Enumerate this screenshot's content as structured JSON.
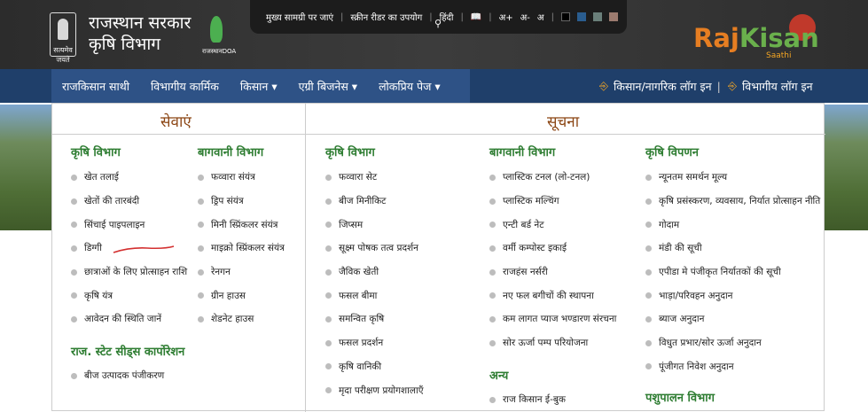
{
  "header": {
    "title_line1": "राजस्थान सरकार",
    "title_line2": "कृषि विभाग",
    "emblem_caption": "सत्यमेव जयते",
    "doa_caption": "राजस्थानDOA"
  },
  "topbar": {
    "skip": "मुख्य सामग्री पर जाएं",
    "reader": "स्क्रीन रीडर का उपयोग",
    "lang": "हिंदी",
    "font_plus": "अ+",
    "font_minus": "अ-",
    "font_normal": "अ",
    "swatches": [
      "#000000",
      "#2a5d8f",
      "#6a7f7a",
      "#9c7b6f"
    ]
  },
  "logo": {
    "part1": "Raj",
    "part2": "Kisan",
    "sub": "Saathi"
  },
  "nav": {
    "items": [
      "राजकिसान साथी",
      "विभागीय कार्मिक",
      "किसान",
      "एग्री बिजनेस",
      "लोकप्रिय पेज"
    ],
    "farmer_login": "किसान/नागरिक लॉग इन",
    "dept_login": "विभागीय लॉग इन"
  },
  "menu": {
    "seva_title": "सेवाएं",
    "suchna_title": "सूचना",
    "seva": {
      "krishi_title": "कृषि विभाग",
      "krishi": [
        "खेत तलाई",
        "खेतों की तारबंदी",
        "सिंचाई पाइपलाइन",
        "डिग्गी",
        "छात्राओं के लिए प्रोत्साहन राशि",
        "कृषि यंत्र",
        "आवेदन की स्थिति जानें"
      ],
      "bagwani_title": "बागवानी विभाग",
      "bagwani": [
        "फव्वारा संयंत्र",
        "ड्रिप संयंत्र",
        "मिनी स्प्रिंकलर संयंत्र",
        "माइक्रो स्प्रिंकलर संयंत्र",
        "रेनगन",
        "ग्रीन हाउस",
        "शेडनेट हाउस"
      ],
      "seeds_title": "राज. स्टेट सीड्स कार्पोरेशन",
      "seeds": [
        "बीज उत्पादक पंजीकरण"
      ]
    },
    "suchna": {
      "krishi_title": "कृषि विभाग",
      "krishi": [
        "फव्वारा सेट",
        "बीज मिनीकिट",
        "जिप्सम",
        "सूक्ष्म पोषक तत्व प्रदर्शन",
        "जैविक खेती",
        "फसल बीमा",
        "समन्वित कृषि",
        "फसल प्रदर्शन",
        "कृषि वानिकी",
        "मृदा परीक्षण प्रयोगशालाएँ"
      ],
      "bagwani_title": "बागवानी विभाग",
      "bagwani": [
        "प्लास्टिक टनल (लो-टनल)",
        "प्लास्टिक मल्चिंग",
        "एन्टी बर्ड नेट",
        "वर्मी कम्पोस्ट इकाई",
        "राजहंस नर्सरी",
        "नए फल बगीचों की स्थापना",
        "कम लागत प्याज भण्डारण संरचना",
        "सोर ऊर्जा पम्प परियोजना"
      ],
      "anya_title": "अन्य",
      "anya": [
        "राज किसान ई-बुक"
      ],
      "vipnan_title": "कृषि विपणन",
      "vipnan": [
        "न्यूनतम समर्थन मूल्य",
        "कृषि प्रसंस्करण, व्यवसाय, निर्यात प्रोत्साहन नीति",
        "गोदाम",
        "मंडी की सूची",
        "एपीडा मे पंजीकृत निर्यातकों की सूची",
        "भाड़ा/परिवहन अनुदान",
        "ब्याज अनुदान",
        "विधुत प्रभार/सोर ऊर्जा अनुदान",
        "पूंजीगत निवेश अनुदान"
      ],
      "pashu_title": "पशुपालन विभाग"
    }
  }
}
